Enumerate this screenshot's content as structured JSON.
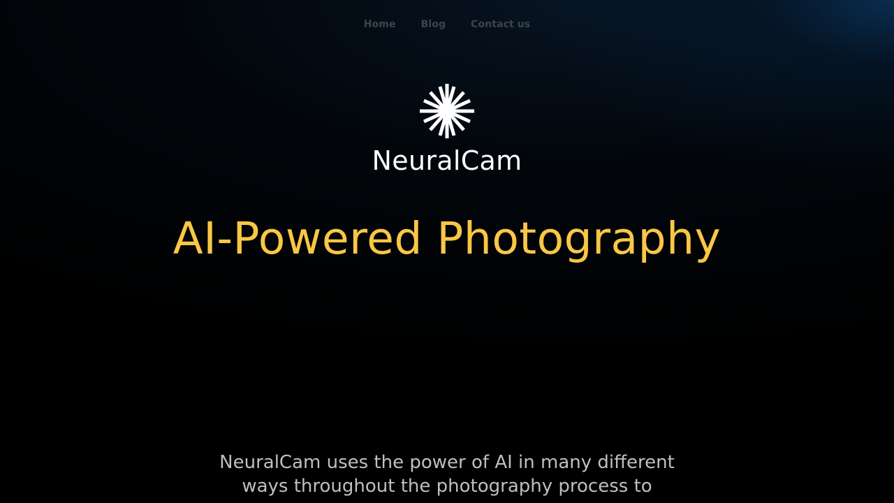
{
  "nav": {
    "items": [
      {
        "label": "Home"
      },
      {
        "label": "Blog"
      },
      {
        "label": "Contact us"
      }
    ]
  },
  "logo": {
    "icon": "starburst-icon",
    "color": "#ffffff"
  },
  "brand": {
    "name": "NeuralCam"
  },
  "hero": {
    "title": "AI-Powered Photography",
    "title_color": "#f9c746",
    "body": "NeuralCam uses the power of AI in many different ways throughout the photography process to"
  },
  "colors": {
    "background": "#000000",
    "glow": "#0a345a",
    "nav_text": "#3d444c",
    "body_text": "#bfbfbf"
  }
}
